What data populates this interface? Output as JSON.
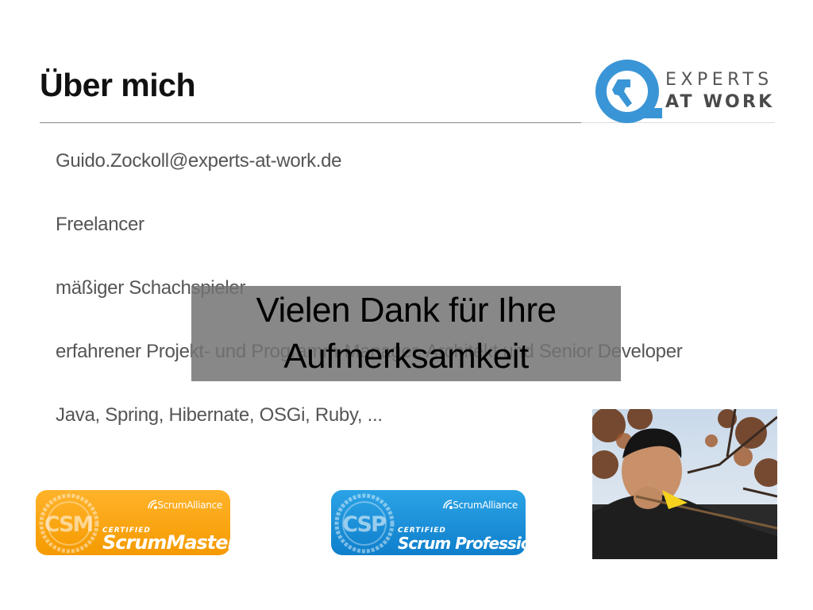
{
  "slide": {
    "title": "Über mich",
    "bullets": [
      "Guido.Zockoll@experts-at-work.de",
      "Freelancer",
      "mäßiger Schachspieler",
      "erfahrener Projekt- und Programm-Manager, Architekt und Senior Developer",
      "Java, Spring, Hibernate, OSGi, Ruby, ..."
    ]
  },
  "logo": {
    "line1": "EXPERTS",
    "line2": "AT WORK",
    "icon": "wrench-circle-icon",
    "color": "#3a95d6"
  },
  "overlay": {
    "line1": "Vielen Dank für Ihre",
    "line2": "Aufmerksamkeit"
  },
  "badges": [
    {
      "seal": "CSM",
      "alliance": "ScrumAlliance",
      "certified": "CERTIFIED",
      "name": "ScrumMaster",
      "color": "#f7a20c"
    },
    {
      "seal": "CSP",
      "alliance": "ScrumAlliance",
      "certified": "CERTIFIED",
      "name": "Scrum Professional",
      "color": "#1a8fdb"
    }
  ],
  "photo": {
    "icon": "portrait-photo"
  }
}
